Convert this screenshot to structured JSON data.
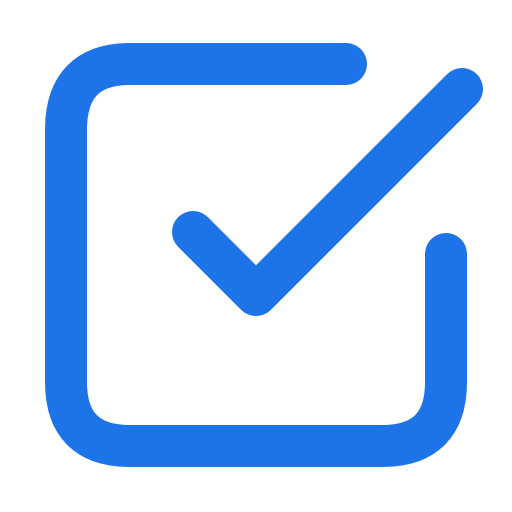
{
  "icon": {
    "name": "checkbox-checked-icon",
    "color": "#1d73e8",
    "state": "checked"
  }
}
